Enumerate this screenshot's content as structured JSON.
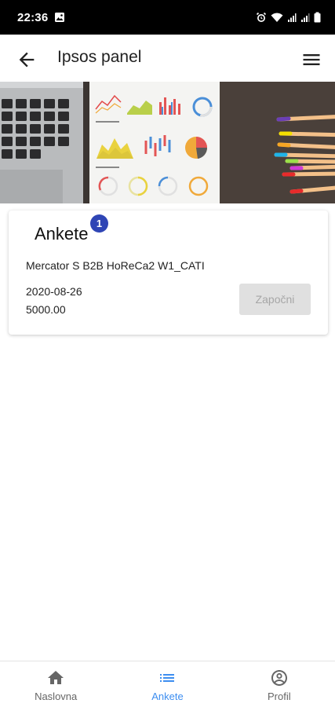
{
  "status_bar": {
    "time": "22:36"
  },
  "app_bar": {
    "title": "Ipsos panel",
    "back_icon": "arrow-back-icon",
    "menu_icon": "hamburger-menu-icon"
  },
  "hero": {
    "icon": "dashboard-charts-image"
  },
  "card": {
    "title": "Ankete",
    "badge_count": "1",
    "survey": {
      "name": "Mercator S B2B HoReCa2 W1_CATI",
      "date": "2020-08-26",
      "amount": "5000.00",
      "start_label": "Započni",
      "start_enabled": false
    }
  },
  "bottom_nav": {
    "items": [
      {
        "label": "Naslovna",
        "icon": "home-icon",
        "active": false
      },
      {
        "label": "Ankete",
        "icon": "list-icon",
        "active": true
      },
      {
        "label": "Profil",
        "icon": "account-circle-icon",
        "active": false
      }
    ]
  },
  "colors": {
    "accent": "#3d8ef0",
    "badge": "#2f45b5",
    "disabled_button": "#e0e0e0"
  }
}
